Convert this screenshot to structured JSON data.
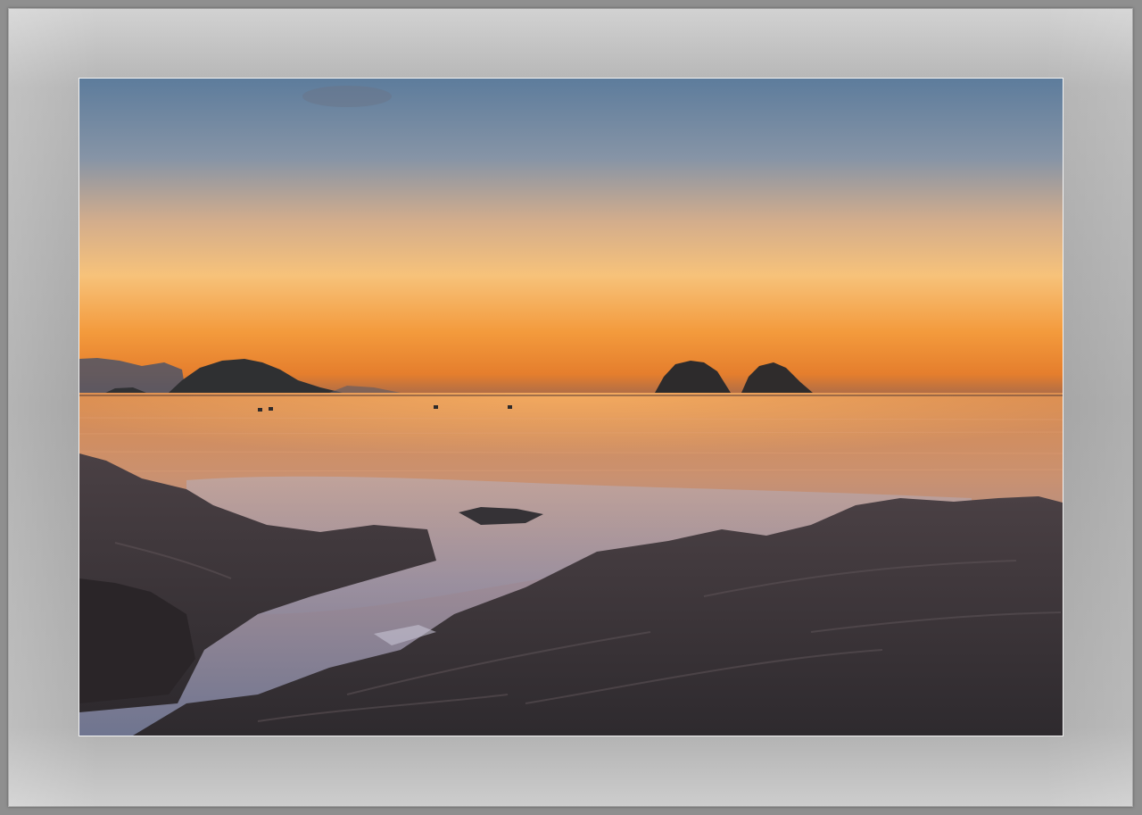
{
  "scene": {
    "subject": "sunset-seascape",
    "colors": {
      "sky_top": "#5f7f9e",
      "sky_mid": "#c9a88a",
      "sky_glow": "#f6b862",
      "horizon": "#ee8a2c",
      "water": "#c88a5f",
      "rock": "#3a3437",
      "mat": "#a8a8a8"
    }
  }
}
